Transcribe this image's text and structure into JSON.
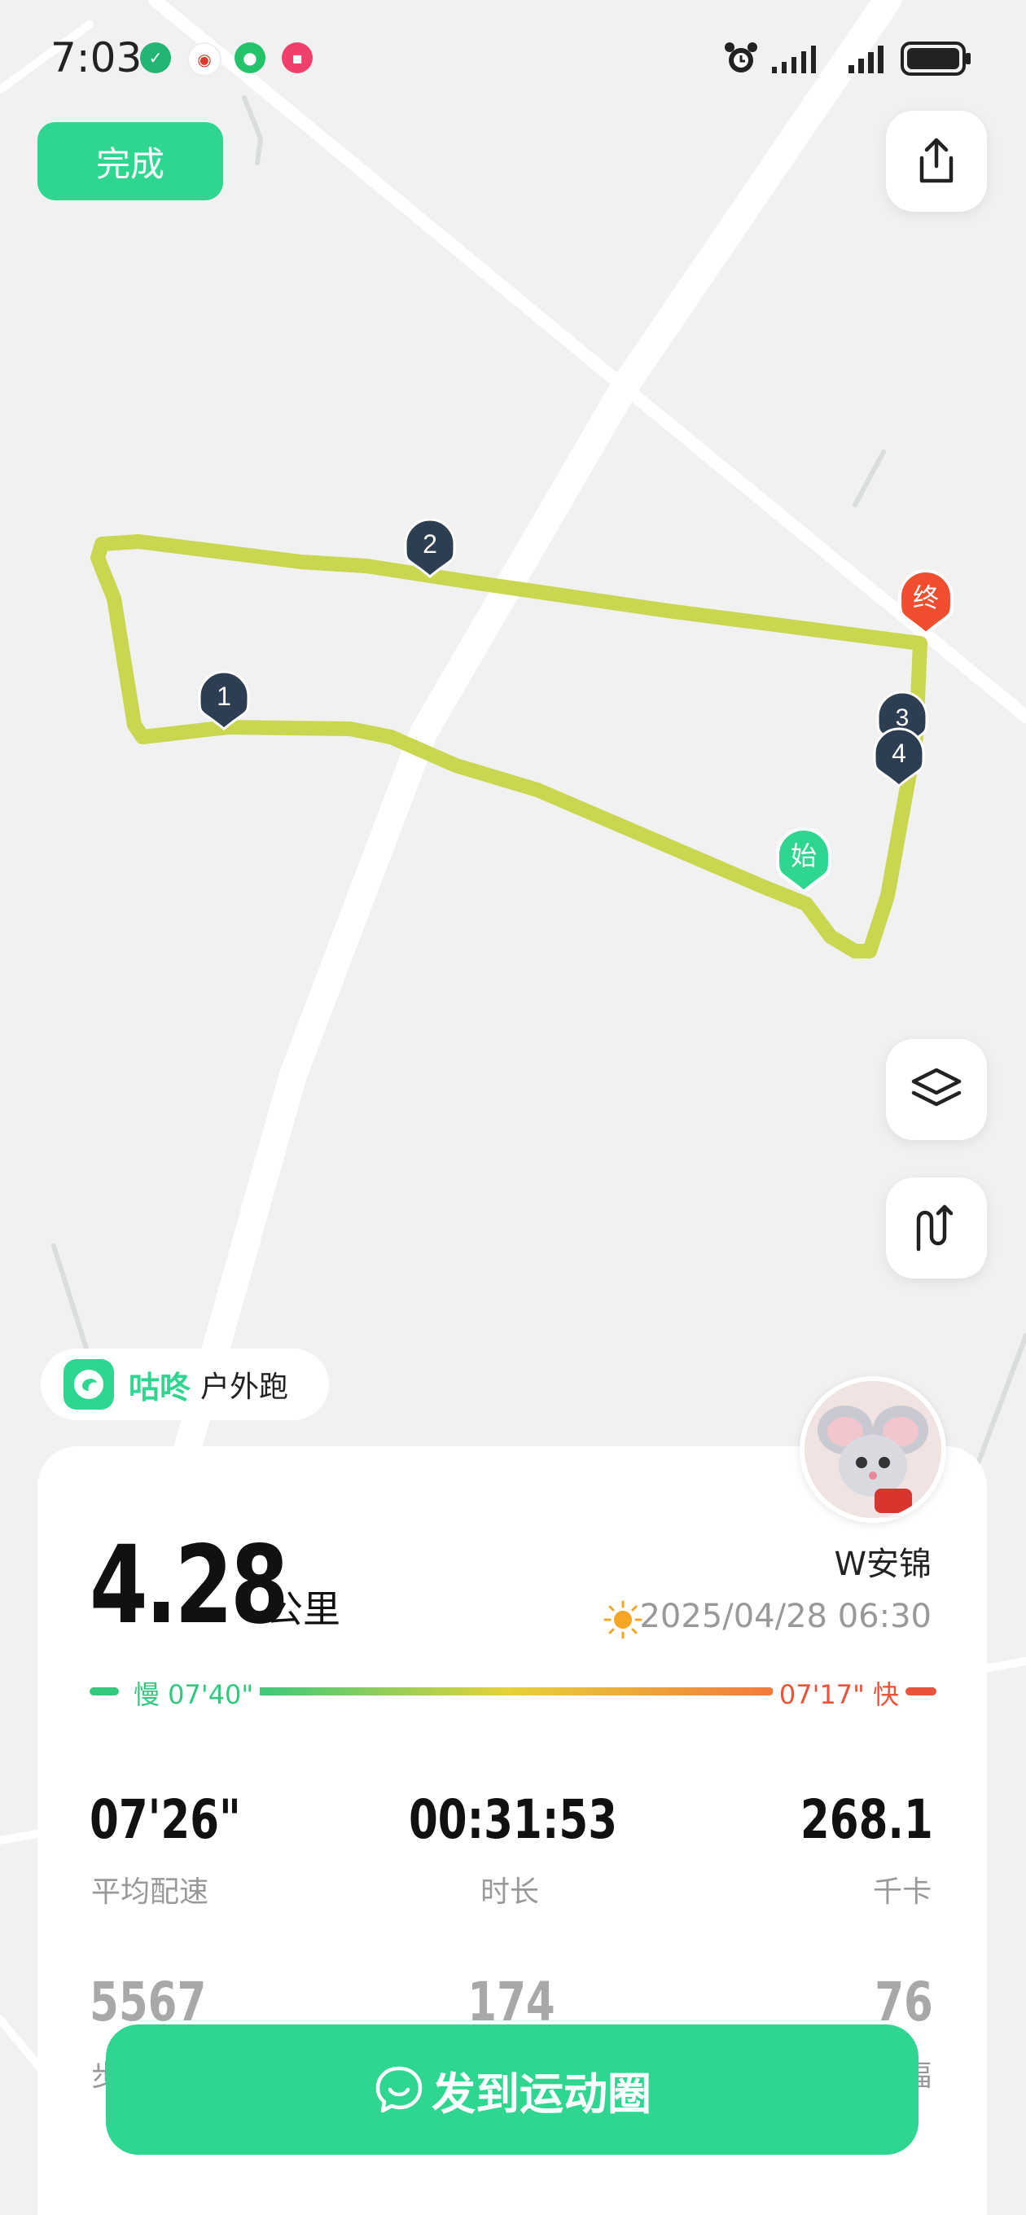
{
  "status_bar": {
    "time": "7:03",
    "icons": [
      "kwai-icon",
      "weibo-icon",
      "message-icon",
      "red-app-icon",
      "alarm-icon",
      "signal-icon",
      "signal-icon",
      "battery-icon"
    ]
  },
  "toolbar": {
    "done_label": "完成"
  },
  "map": {
    "route_color": "#c9d650",
    "markers": [
      "1",
      "2",
      "3",
      "4"
    ],
    "start_label": "始",
    "end_label": "终"
  },
  "brand": {
    "name": "咕咚",
    "type": "户外跑"
  },
  "summary": {
    "distance": "4.28",
    "distance_unit": "公里",
    "user": "W安锦",
    "datetime": "2025/04/28 06:30",
    "pace_slow": "慢 07'40\"",
    "pace_fast": "07'17\" 快"
  },
  "stats": [
    {
      "value": "07'26\"",
      "label": "平均配速"
    },
    {
      "value": "00:31:53",
      "label": "时长"
    },
    {
      "value": "268.1",
      "label": "千卡"
    },
    {
      "value": "5567",
      "label": "步"
    },
    {
      "value": "174",
      "label": ""
    },
    {
      "value": "76",
      "label": "幅"
    }
  ],
  "share": {
    "label": "发到运动圈"
  },
  "colors": {
    "accent": "#2ed68f",
    "slow": "#32c97f",
    "fast": "#e8533a",
    "end_marker": "#f04e2f"
  }
}
